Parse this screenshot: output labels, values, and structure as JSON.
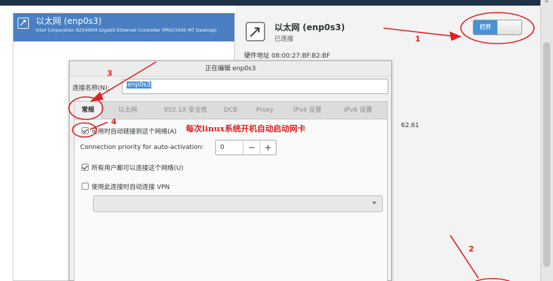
{
  "network_list": {
    "item_name": "以太网 (enp0s3)",
    "item_desc": "Intel Corporation 82540EM Gigabit Ethernet Controller (PRO/1000 MT Desktop)"
  },
  "details": {
    "title": "以太网 (enp0s3)",
    "status": "已连接",
    "hw_address": "硬件地址  08:00:27:BF:B2:BF",
    "ip_fragment": "62.61"
  },
  "toggle": {
    "label": "打开",
    "state": "on"
  },
  "dialog": {
    "title": "正在编辑 enp0s3",
    "name_label": "连接名称(N):",
    "name_value": "enp0s3",
    "tabs": [
      "常规",
      "以太网",
      "802.1X 安全性",
      "DCB",
      "Proxy",
      "IPv4 设置",
      "IPv6 设置"
    ],
    "auto_connect_label": "可用时自动链接到这个网络(A)",
    "priority_label": "Connection priority for auto-activation:",
    "priority_value": "0",
    "minus": "−",
    "plus": "+",
    "all_users_label": "所有用户都可以连接这个网络(U)",
    "vpn_label": "使用此连接时自动连接 VPN",
    "vpn_selected": ""
  },
  "annotations": {
    "n1": "1",
    "n2": "2",
    "n3": "3",
    "n4": "4",
    "note": "每次linux系统开机自动启动网卡"
  },
  "colors": {
    "accent": "#4a90d9",
    "annotation": "#e02020",
    "selection": "#4a7fc1"
  }
}
